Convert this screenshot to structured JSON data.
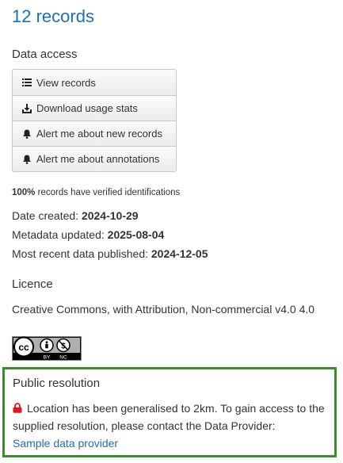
{
  "header": {
    "records_title": "12 records"
  },
  "data_access": {
    "heading": "Data access",
    "buttons": [
      {
        "label": "View records",
        "icon": "list-icon"
      },
      {
        "label": "Download usage stats",
        "icon": "download-icon"
      },
      {
        "label": "Alert me about new records",
        "icon": "bell-icon"
      },
      {
        "label": "Alert me about annotations",
        "icon": "bell-icon"
      }
    ]
  },
  "verification": {
    "percent": "100%",
    "text": " records have verified identifications"
  },
  "metadata": {
    "date_created_label": "Date created: ",
    "date_created_value": "2024-10-29",
    "updated_label": "Metadata updated: ",
    "updated_value": "2025-08-04",
    "published_label": "Most recent data published: ",
    "published_value": "2024-12-05"
  },
  "licence": {
    "heading": "Licence",
    "text": "Creative Commons, with Attribution, Non-commercial v4.0 4.0",
    "badge_icon": "cc-by-nc-icon",
    "badge_text_left": "BY",
    "badge_text_right": "NC"
  },
  "public_resolution": {
    "heading": "Public resolution",
    "text": "Location has been generalised to 2km. To gain access to the supplied resolution, please contact the Data Provider:",
    "link_text": "Sample data provider",
    "icon": "lock-icon",
    "border_color": "#3d8b2f"
  },
  "colors": {
    "accent": "#1f6fb2",
    "lock": "#d9191f"
  }
}
